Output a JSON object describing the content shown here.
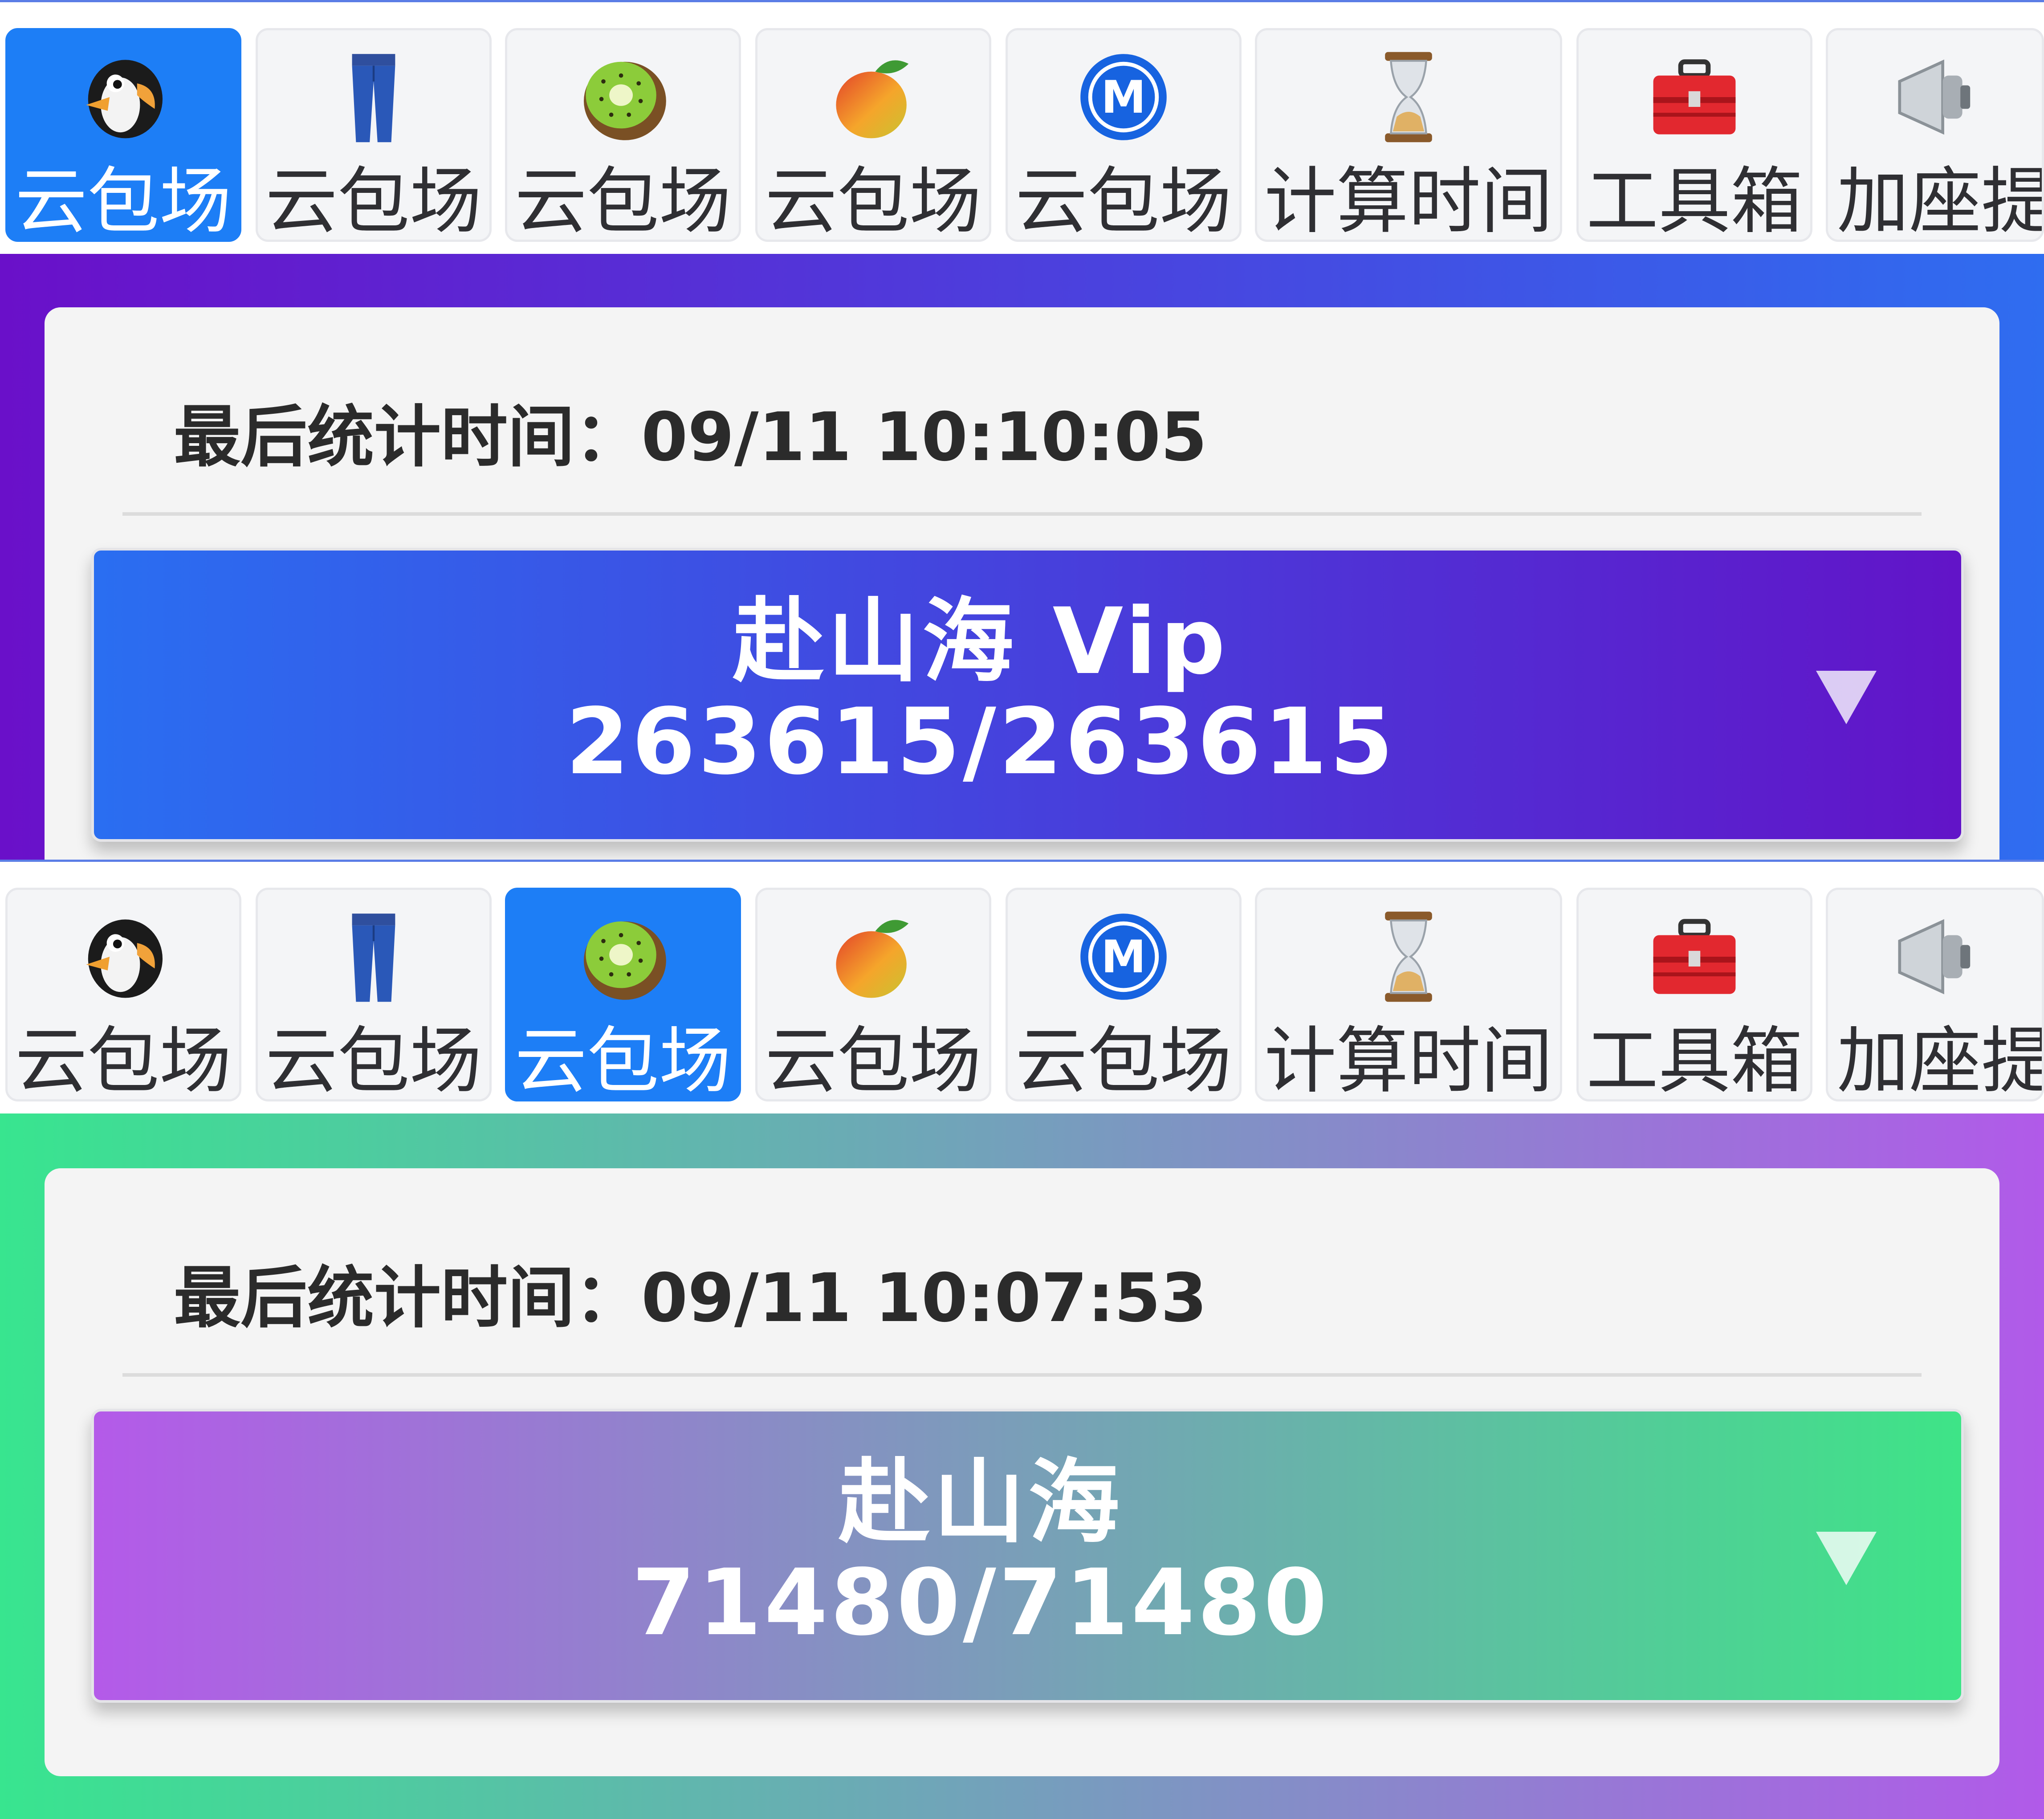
{
  "screens": [
    {
      "active_tab": 0,
      "tabs": [
        {
          "label": "云包场",
          "icon": "penguin-icon"
        },
        {
          "label": "云包场",
          "icon": "jeans-icon"
        },
        {
          "label": "云包场",
          "icon": "kiwi-icon"
        },
        {
          "label": "云包场",
          "icon": "mango-icon"
        },
        {
          "label": "云包场",
          "icon": "metro-m-icon"
        },
        {
          "label": "计算时间",
          "icon": "hourglass-icon"
        },
        {
          "label": "工具箱",
          "icon": "toolbox-icon"
        },
        {
          "label": "加座提",
          "icon": "megaphone-icon"
        }
      ],
      "stat": {
        "label": "最后统计时间：",
        "time": "09/11 10:10:05"
      },
      "dropdown": {
        "name": "赴山海 Vip",
        "count": "263615/263615"
      },
      "colors": {
        "gradient_start": "#6a10c9",
        "gradient_end": "#2f6df0"
      }
    },
    {
      "active_tab": 2,
      "tabs": [
        {
          "label": "云包场",
          "icon": "penguin-icon"
        },
        {
          "label": "云包场",
          "icon": "jeans-icon"
        },
        {
          "label": "云包场",
          "icon": "kiwi-icon"
        },
        {
          "label": "云包场",
          "icon": "mango-icon"
        },
        {
          "label": "云包场",
          "icon": "metro-m-icon"
        },
        {
          "label": "计算时间",
          "icon": "hourglass-icon"
        },
        {
          "label": "工具箱",
          "icon": "toolbox-icon"
        },
        {
          "label": "加座提",
          "icon": "megaphone-icon"
        }
      ],
      "stat": {
        "label": "最后统计时间：",
        "time": "09/11 10:07:53"
      },
      "dropdown": {
        "name": "赴山海",
        "count": "71480/71480"
      },
      "colors": {
        "gradient_start": "#38e58f",
        "gradient_end": "#b15ae9"
      }
    }
  ],
  "accent": "#1d7ef6"
}
